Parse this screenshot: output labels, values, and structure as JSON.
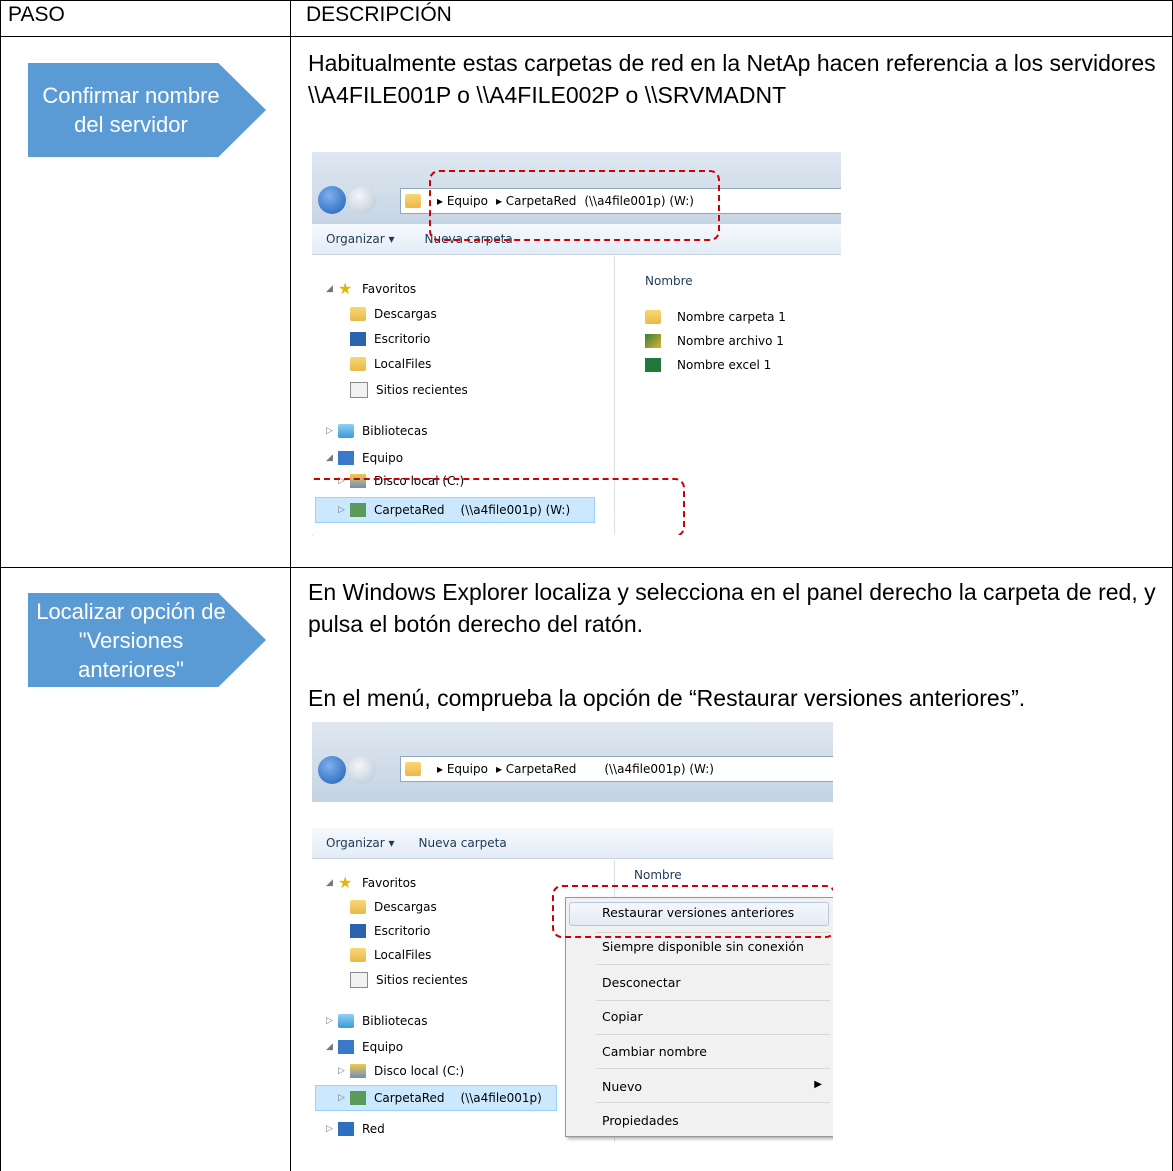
{
  "table": {
    "header_step": "PASO",
    "header_desc": "DESCRIPCIÓN"
  },
  "rows": [
    {
      "step_label": "Confirmar nombre del servidor",
      "paragraphs": [
        "Habitualmente estas carpetas de red en la NetAp hacen referencia a los servidores \\\\A4FILE001P o \\\\A4FILE002P o \\\\SRVMADNT"
      ]
    },
    {
      "step_label": "Localizar opción de \"Versiones anteriores\"",
      "paragraphs": [
        "En Windows Explorer localiza y selecciona en el panel derecho la carpeta de red, y pulsa el botón derecho del ratón.",
        "En el menú, comprueba la opción de “Restaurar versiones anteriores”."
      ]
    }
  ],
  "explorer1": {
    "address": [
      "Equipo",
      "CarpetaRed",
      "(\\\\a4file001p) (W:)"
    ],
    "toolbar": [
      "Organizar ▾",
      "Nueva carpeta"
    ],
    "nav": {
      "favoritos": "Favoritos",
      "favorites_items": [
        "Descargas",
        "Escritorio",
        "LocalFiles",
        "Sitios recientes"
      ],
      "bibliotecas": "Bibliotecas",
      "equipo": "Equipo",
      "disco": "Disco local (C:)",
      "carpeta": "CarpetaRed",
      "carpeta_path": "(\\\\a4file001p) (W:)"
    },
    "column_header": "Nombre",
    "files": [
      "Nombre carpeta 1",
      "Nombre archivo 1",
      "Nombre excel 1"
    ]
  },
  "explorer2": {
    "address": [
      "Equipo",
      "CarpetaRed",
      "(\\\\a4file001p) (W:)"
    ],
    "toolbar": [
      "Organizar ▾",
      "Nueva carpeta"
    ],
    "nav": {
      "favoritos": "Favoritos",
      "favorites_items": [
        "Descargas",
        "Escritorio",
        "LocalFiles",
        "Sitios recientes"
      ],
      "bibliotecas": "Bibliotecas",
      "equipo": "Equipo",
      "disco": "Disco local (C:)",
      "carpeta": "CarpetaRed",
      "carpeta_path": "(\\\\a4file001p)",
      "red": "Red"
    },
    "column_header": "Nombre",
    "context_menu": [
      "Restaurar versiones anteriores",
      "Siempre disponible sin conexión",
      "Desconectar",
      "Copiar",
      "Cambiar nombre",
      "Nuevo",
      "Propiedades"
    ]
  },
  "colors": {
    "arrow": "#5b9bd5",
    "highlight": "#d00000"
  }
}
